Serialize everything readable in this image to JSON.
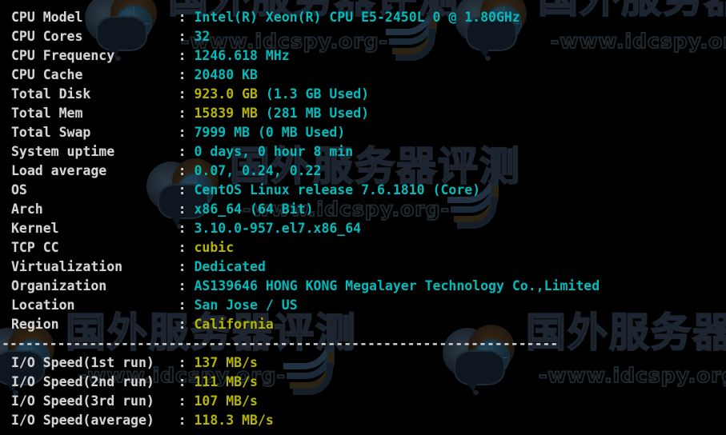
{
  "terminal": {
    "background_color": "#000000",
    "label_color": "#d4d4d4",
    "value_cyan": "#00bcbc",
    "value_yellow": "#b5b500",
    "colon": ":",
    "separator": "----------------------------------------------------------------------"
  },
  "watermark": {
    "text_cn": "国外服务器评测",
    "text_url": "-www.idcspy.org-"
  },
  "system_info": [
    {
      "label": "CPU Model",
      "value": "Intel(R) Xeon(R) CPU E5-2450L 0 @ 1.80GHz",
      "color": "cyan"
    },
    {
      "label": "CPU Cores",
      "value": "32",
      "color": "cyan"
    },
    {
      "label": "CPU Frequency",
      "value": "1246.618 MHz",
      "color": "cyan"
    },
    {
      "label": "CPU Cache",
      "value": "20480 KB",
      "color": "cyan"
    },
    {
      "label": "Total Disk",
      "value": "923.0 GB",
      "value2": " (1.3 GB Used)",
      "color": "yellow",
      "color2": "cyan"
    },
    {
      "label": "Total Mem",
      "value": "15839 MB",
      "value2": " (281 MB Used)",
      "color": "yellow",
      "color2": "cyan"
    },
    {
      "label": "Total Swap",
      "value": "7999 MB (0 MB Used)",
      "color": "cyan"
    },
    {
      "label": "System uptime",
      "value": "0 days, 0 hour 8 min",
      "color": "cyan"
    },
    {
      "label": "Load average",
      "value": "0.07, 0.24, 0.22",
      "color": "cyan"
    },
    {
      "label": "OS",
      "value": "CentOS Linux release 7.6.1810 (Core)",
      "color": "cyan"
    },
    {
      "label": "Arch",
      "value": "x86_64 (64 Bit)",
      "color": "cyan"
    },
    {
      "label": "Kernel",
      "value": "3.10.0-957.el7.x86_64",
      "color": "cyan"
    },
    {
      "label": "TCP CC",
      "value": "cubic",
      "color": "yellow"
    },
    {
      "label": "Virtualization",
      "value": "Dedicated",
      "color": "cyan"
    },
    {
      "label": "Organization",
      "value": "AS139646 HONG KONG Megalayer Technology Co.,Limited",
      "color": "cyan"
    },
    {
      "label": "Location",
      "value": "San Jose / US",
      "color": "cyan"
    },
    {
      "label": "Region",
      "value": "California",
      "color": "yellow"
    }
  ],
  "io_speed": [
    {
      "label": "I/O Speed(1st run)",
      "value": "137 MB/s",
      "color": "yellow"
    },
    {
      "label": "I/O Speed(2nd run)",
      "value": "111 MB/s",
      "color": "yellow"
    },
    {
      "label": "I/O Speed(3rd run)",
      "value": "107 MB/s",
      "color": "yellow"
    },
    {
      "label": "I/O Speed(average)",
      "value": "118.3 MB/s",
      "color": "yellow"
    }
  ]
}
